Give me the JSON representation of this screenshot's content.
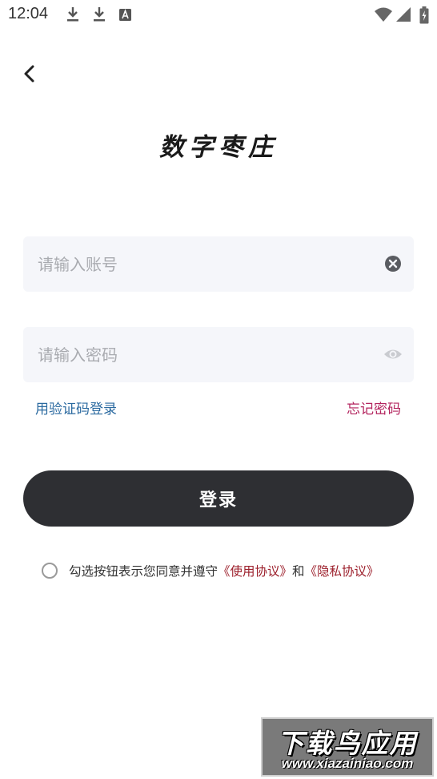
{
  "status_bar": {
    "time": "12:04",
    "icons": [
      "download-icon",
      "download-icon",
      "a-icon",
      "wifi-icon",
      "signal-icon",
      "battery-icon"
    ]
  },
  "back": {
    "icon": "chevron-left-icon"
  },
  "logo": {
    "text": "数字枣庄"
  },
  "account_field": {
    "placeholder": "请输入账号",
    "value": "",
    "icon": "clear-icon"
  },
  "password_field": {
    "placeholder": "请输入密码",
    "value": "",
    "icon": "eye-icon"
  },
  "links": {
    "sms_login": "用验证码登录",
    "forgot_password": "忘记密码"
  },
  "login_button": {
    "label": "登录"
  },
  "agreement": {
    "prefix": "勾选按钮表示您同意并遵守",
    "terms": "《使用协议》",
    "conjunction": "和",
    "privacy": "《隐私协议》"
  },
  "watermark": {
    "top": "下载鸟应用",
    "bottom": "www.xiazainiao.com"
  },
  "colors": {
    "input_bg": "#f5f6fa",
    "button_bg": "#2e2f33",
    "link_blue": "#2b6aa0",
    "link_red": "#b3245e",
    "agreement_link": "#9c1f2b"
  }
}
